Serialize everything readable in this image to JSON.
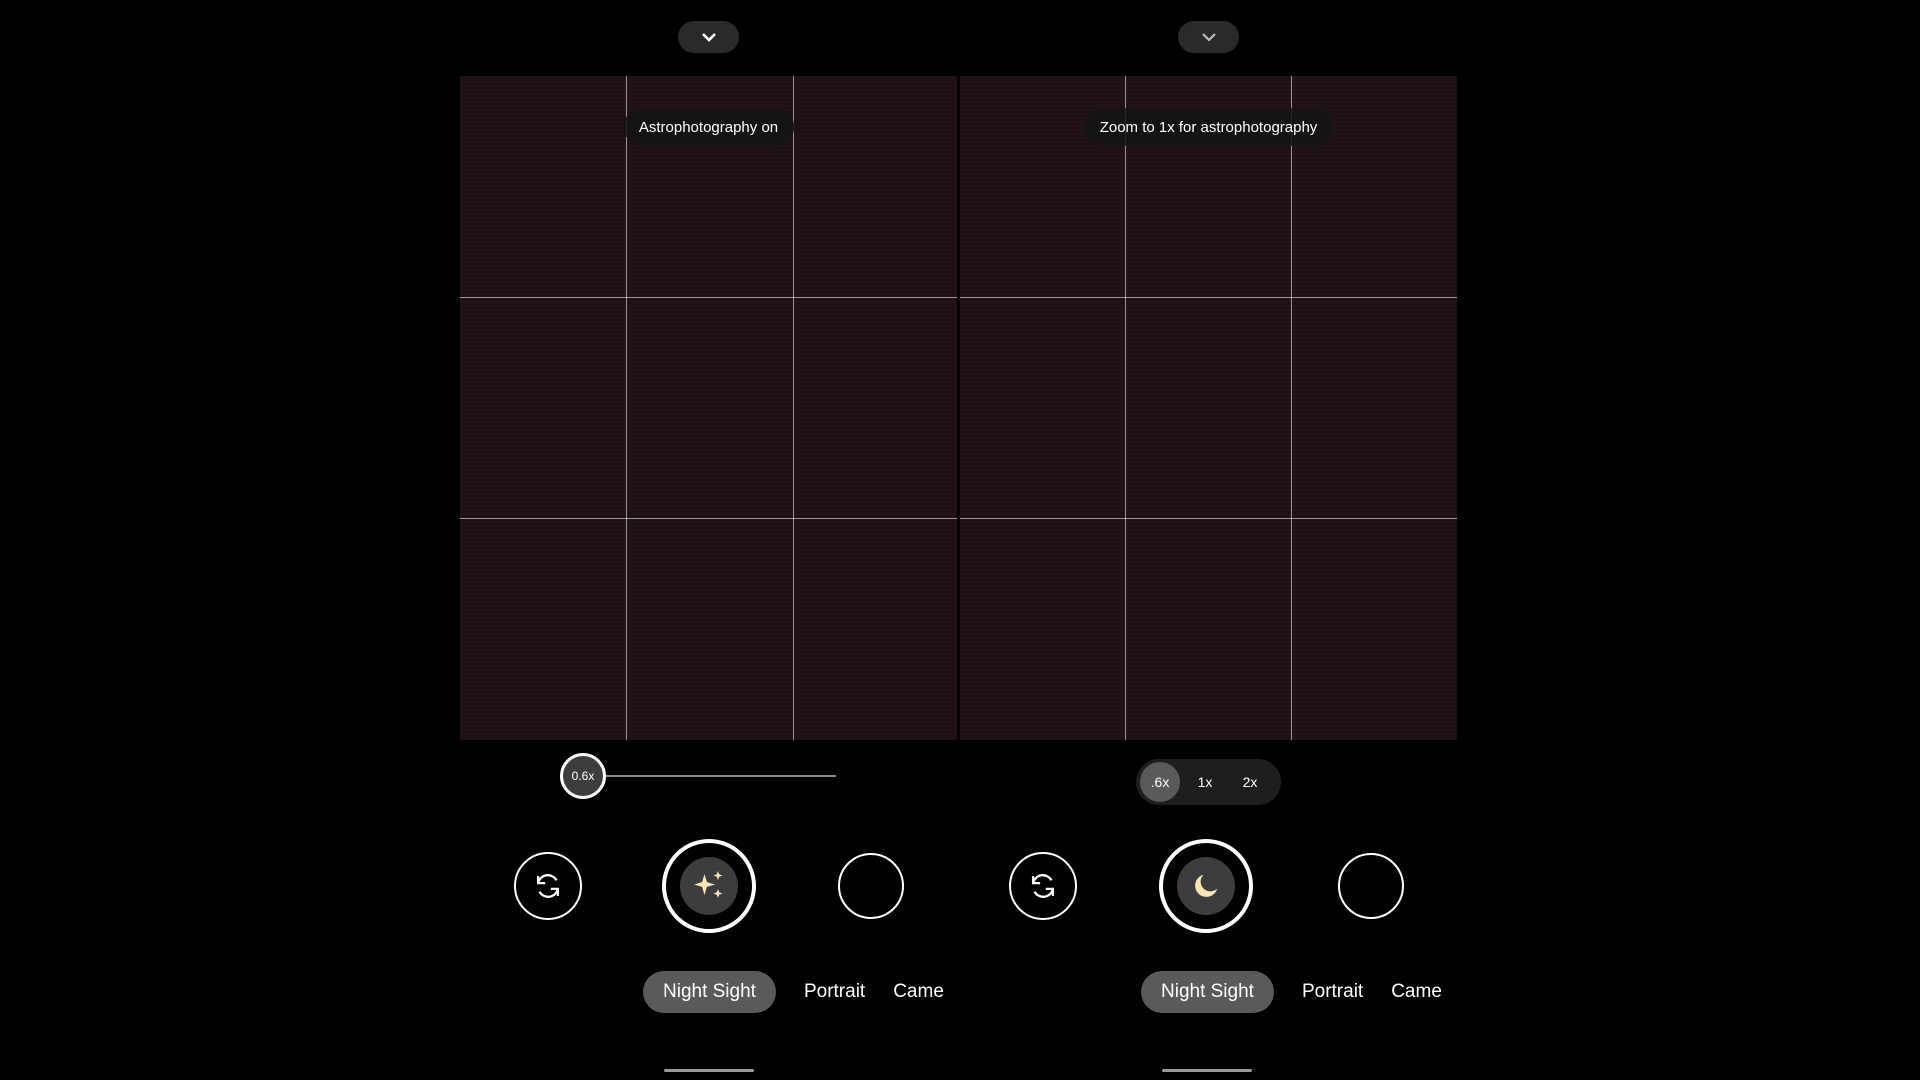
{
  "left_panel": {
    "tooltip": "Astrophotography on",
    "zoom_slider": {
      "label": "0.6x",
      "value": 0.6
    },
    "shutter_icon": "sparkles-icon",
    "modes": {
      "active": "Night Sight",
      "items": [
        "Portrait",
        "Came"
      ]
    }
  },
  "right_panel": {
    "tooltip": "Zoom to 1x for astrophotography",
    "zoom_options": [
      ".6x",
      "1x",
      "2x"
    ],
    "zoom_selected": ".6x",
    "shutter_icon": "moon-icon",
    "modes": {
      "active": "Night Sight",
      "items": [
        "Portrait",
        "Came"
      ]
    }
  },
  "colors": {
    "icon_accent": "#fbe5b0",
    "chip_bg": "#5a5a5a",
    "shutter_inner": "#3c3d3f"
  }
}
